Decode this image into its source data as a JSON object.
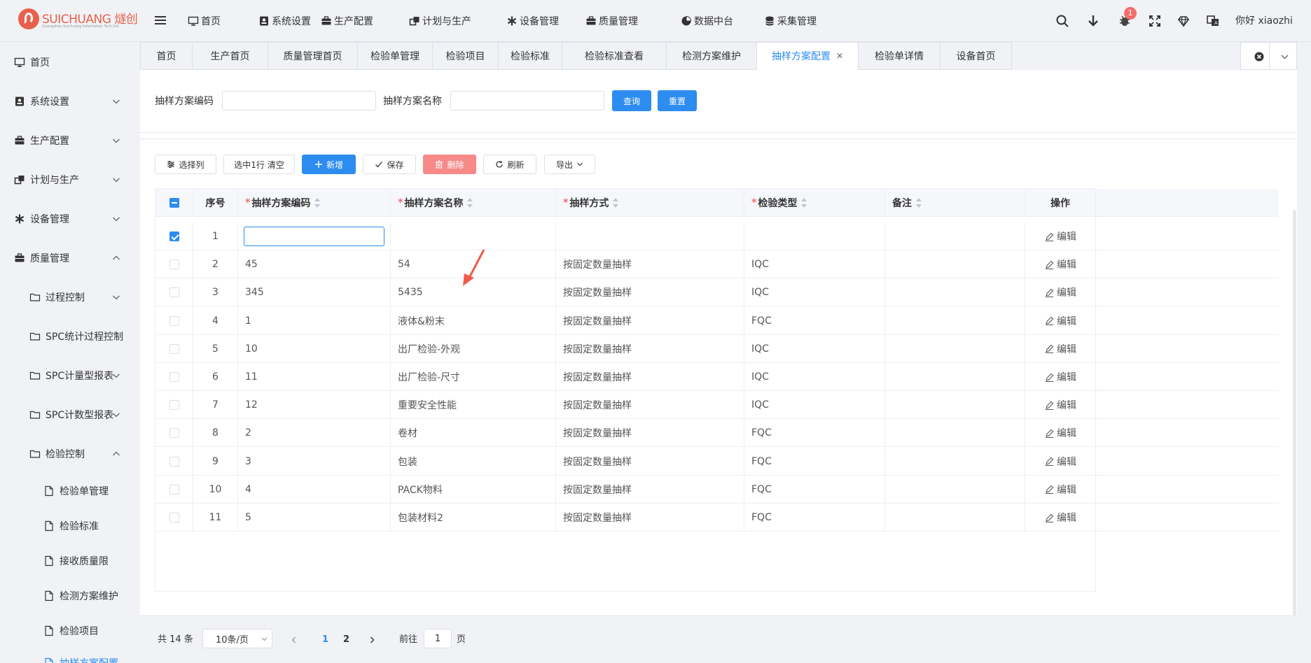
{
  "header": {
    "logo_brand": "SUICHUANG 燧创",
    "logo_sub": "Guangzhou Suichuang Information Tech Ltd",
    "nav": [
      {
        "label": "首页",
        "icon": "monitor-icon"
      },
      {
        "label": "系统设置",
        "icon": "settings-box-icon"
      },
      {
        "label": "生产配置",
        "icon": "briefcase-icon"
      },
      {
        "label": "计划与生产",
        "icon": "plan-icon"
      },
      {
        "label": "设备管理",
        "icon": "asterisk-icon"
      },
      {
        "label": "质量管理",
        "icon": "briefcase-icon"
      },
      {
        "label": "数据中台",
        "icon": "pie-chart-icon"
      },
      {
        "label": "采集管理",
        "icon": "database-icon"
      }
    ],
    "notification_count": "1",
    "greeting": "你好 xiaozhi"
  },
  "sidebar": {
    "items": [
      {
        "label": "首页",
        "icon": "monitor-icon",
        "chevron": ""
      },
      {
        "label": "系统设置",
        "icon": "settings-box-icon",
        "chevron": "down"
      },
      {
        "label": "生产配置",
        "icon": "briefcase-icon",
        "chevron": "down"
      },
      {
        "label": "计划与生产",
        "icon": "plan-icon",
        "chevron": "down"
      },
      {
        "label": "设备管理",
        "icon": "asterisk-icon",
        "chevron": "down"
      },
      {
        "label": "质量管理",
        "icon": "briefcase-icon",
        "chevron": "up"
      },
      {
        "label": "过程控制",
        "icon": "folder-icon",
        "chevron": "down"
      },
      {
        "label": "SPC统计过程控制",
        "icon": "folder-icon",
        "chevron": ""
      },
      {
        "label": "SPC计量型报表",
        "icon": "folder-icon",
        "chevron": "down"
      },
      {
        "label": "SPC计数型报表",
        "icon": "folder-icon",
        "chevron": "down"
      },
      {
        "label": "检验控制",
        "icon": "folder-icon",
        "chevron": "up"
      },
      {
        "label": "检验单管理",
        "icon": "file-icon",
        "chevron": ""
      },
      {
        "label": "检验标准",
        "icon": "file-icon",
        "chevron": ""
      },
      {
        "label": "接收质量限",
        "icon": "file-icon",
        "chevron": ""
      },
      {
        "label": "检测方案维护",
        "icon": "file-icon",
        "chevron": ""
      },
      {
        "label": "检验项目",
        "icon": "file-icon",
        "chevron": ""
      },
      {
        "label": "抽样方案配置",
        "icon": "file-icon",
        "chevron": ""
      }
    ]
  },
  "tabs": [
    {
      "label": "首页"
    },
    {
      "label": "生产首页"
    },
    {
      "label": "质量管理首页"
    },
    {
      "label": "检验单管理"
    },
    {
      "label": "检验项目"
    },
    {
      "label": "检验标准"
    },
    {
      "label": "检验标准查看"
    },
    {
      "label": "检测方案维护"
    },
    {
      "label": "抽样方案配置",
      "active": true
    },
    {
      "label": "检验单详情"
    },
    {
      "label": "设备首页"
    }
  ],
  "search": {
    "code_label": "抽样方案编码",
    "code_value": "",
    "name_label": "抽样方案名称",
    "name_value": "",
    "query_button": "查询",
    "reset_button": "重置"
  },
  "toolbar": {
    "select_columns": "选择列",
    "clear_selection": "选中1行 清空",
    "add": "新增",
    "save": "保存",
    "delete": "删除",
    "refresh": "刷新",
    "export": "导出"
  },
  "table": {
    "columns": [
      {
        "label": "序号",
        "required": false
      },
      {
        "label": "抽样方案编码",
        "required": true
      },
      {
        "label": "抽样方案名称",
        "required": true
      },
      {
        "label": "抽样方式",
        "required": true
      },
      {
        "label": "检验类型",
        "required": true
      },
      {
        "label": "备注",
        "required": false
      },
      {
        "label": "操作",
        "required": false
      }
    ],
    "edit_label": "编辑",
    "rows": [
      {
        "index": "1",
        "code": "",
        "name": "",
        "method": "",
        "type": "",
        "remark": "",
        "checked": true,
        "editing": true
      },
      {
        "index": "2",
        "code": "45",
        "name": "54",
        "method": "按固定数量抽样",
        "type": "IQC",
        "remark": ""
      },
      {
        "index": "3",
        "code": "345",
        "name": "5435",
        "method": "按固定数量抽样",
        "type": "IQC",
        "remark": ""
      },
      {
        "index": "4",
        "code": "1",
        "name": "液体&粉末",
        "method": "按固定数量抽样",
        "type": "FQC",
        "remark": ""
      },
      {
        "index": "5",
        "code": "10",
        "name": "出厂检验-外观",
        "method": "按固定数量抽样",
        "type": "IQC",
        "remark": ""
      },
      {
        "index": "6",
        "code": "11",
        "name": "出厂检验-尺寸",
        "method": "按固定数量抽样",
        "type": "IQC",
        "remark": ""
      },
      {
        "index": "7",
        "code": "12",
        "name": "重要安全性能",
        "method": "按固定数量抽样",
        "type": "IQC",
        "remark": ""
      },
      {
        "index": "8",
        "code": "2",
        "name": "卷材",
        "method": "按固定数量抽样",
        "type": "FQC",
        "remark": ""
      },
      {
        "index": "9",
        "code": "3",
        "name": "包装",
        "method": "按固定数量抽样",
        "type": "FQC",
        "remark": ""
      },
      {
        "index": "10",
        "code": "4",
        "name": "PACK物料",
        "method": "按固定数量抽样",
        "type": "FQC",
        "remark": ""
      },
      {
        "index": "11",
        "code": "5",
        "name": "包装材料2",
        "method": "按固定数量抽样",
        "type": "FQC",
        "remark": ""
      }
    ]
  },
  "pagination": {
    "total": "共 14 条",
    "page_size": "10条/页",
    "pages": [
      "1",
      "2"
    ],
    "current_page": "1",
    "goto_label": "前往",
    "goto_value": "1",
    "page_suffix": "页"
  },
  "colors": {
    "primary": "#2d8cf0",
    "danger": "#f78989",
    "badge": "#f56c6c",
    "brand": "#e8604c"
  }
}
